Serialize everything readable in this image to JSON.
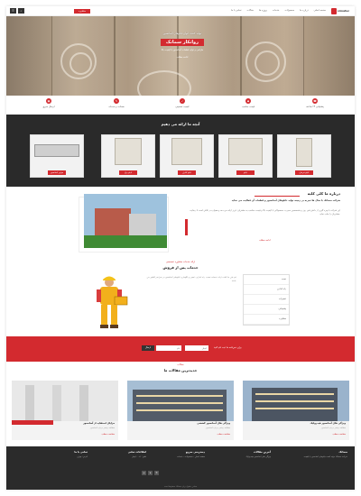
{
  "header": {
    "logo_text": "simatec",
    "nav": [
      "صفحه اصلی",
      "درباره ما",
      "محصولات",
      "خدمات",
      "پروژه ها",
      "مقالات",
      "تماس با ما"
    ],
    "cta": "مشاوره",
    "icons": [
      "menu-icon",
      "search-icon"
    ]
  },
  "hero": {
    "subtitle": "تولید کننده انواع تابلوهای آسانسور",
    "title": "روانکار سماتک",
    "desc": "طراحی و تولید قطعات آسانسور با کیفیت بالا",
    "link": "ادامه مطلب"
  },
  "features": [
    {
      "label": "پشتیبانی ۲۴ ساعته",
      "icon": "phone-icon"
    },
    {
      "label": "قیمت مناسب",
      "icon": "tag-icon"
    },
    {
      "label": "کیفیت تضمینی",
      "icon": "shield-icon"
    },
    {
      "label": "ضمانت و خدمات",
      "icon": "tools-icon"
    },
    {
      "label": "ارسال سریع",
      "icon": "truck-icon"
    }
  ],
  "products": {
    "title": "آنچه ما ارائه می دهیم",
    "items": [
      "تابلو فرمان",
      "تابلو",
      "تابلو کنترل",
      "تابلو برق",
      "موتور آسانسور"
    ]
  },
  "about": {
    "title": "درباره ما کلی کلیه",
    "lead": "شرکت سماتک با سال ها تجربه در زمینه تولید تابلوهای آسانسور و قطعات آن فعالیت می نماید",
    "body": "این شرکت با بهره گیری از دانش فنی روز و متخصصین مجرب، محصولاتی با کیفیت بالا و قیمت مناسب به مشتریان عزیز ارائه می دهد و همواره در تلاش است تا رضایت مشتریان را جلب نماید.",
    "more": "ادامه مطلب"
  },
  "services": {
    "kicker": "ارائه خدمات مشاوره تخصصی",
    "title": "خدمات پس از فروش",
    "text": "تیم فنی ما آماده ارائه خدمات نصب، راه اندازی، تعمیر و نگهداری تابلوهای آسانسور در سراسر کشور می باشد.",
    "list": [
      "نصب",
      "راه اندازی",
      "تعمیرات",
      "پشتیبانی",
      "مشاوره"
    ]
  },
  "newsletter": {
    "label": "برای خبرنامه ما ثبت نام کنید",
    "placeholder_email": "ایمیل",
    "placeholder_name": "نام",
    "send": "ارسال"
  },
  "blog": {
    "kicker": "مقالات",
    "title": "جدیدترین مقالات ما",
    "posts": [
      {
        "caption": "ویژگی های آسانسور هیدرولیک",
        "excerpt": "مطالعه بیشتر درباره آسانسور",
        "more": "مشاهده مطلب"
      },
      {
        "caption": "ویژگی های آسانسور کششی",
        "excerpt": "مطالعه بیشتر درباره آسانسور",
        "more": "مشاهده مطلب"
      },
      {
        "caption": "مزایای استفاده از آسانسور",
        "excerpt": "مطالعه بیشتر درباره آسانسور",
        "more": "مشاهده مطلب"
      }
    ]
  },
  "footer": {
    "cols": [
      {
        "h": "سماتک",
        "l": "شرکت سماتک تولید کننده تابلوهای آسانسور با کیفیت"
      },
      {
        "h": "آخرین مقالات",
        "l": "ویژگی های آسانسور هیدرولیک"
      },
      {
        "h": "دسترسی سریع",
        "l": "صفحه اصلی - محصولات - خدمات"
      },
      {
        "h": "اطلاعات تماس",
        "l": "تلفن: ۰۲۱ - ایمیل"
      },
      {
        "h": "تماس با ما",
        "l": "آدرس: تهران"
      }
    ],
    "copyright": "تمامی حقوق برای سماتک محفوظ است"
  }
}
